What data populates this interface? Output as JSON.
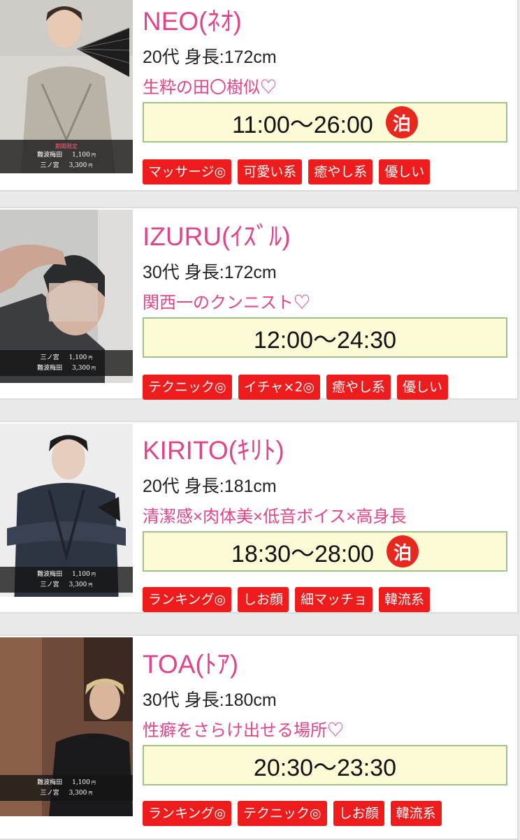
{
  "colors": {
    "accent": "#e0458a",
    "tag_bg": "#ee1c1c",
    "hours_bg": "#fcfbd6",
    "hours_border": "#9fc28a",
    "stay_badge": "#e8281e"
  },
  "cast": [
    {
      "name": "NEO(ﾈｵ)",
      "info": "20代 身長:172cm",
      "catch": "生粋の田〇樹似♡",
      "hours": "11:00〜26:00",
      "stay": "泊",
      "price_note": "期間限定",
      "prices": [
        {
          "area": "難波梅田",
          "price": "1,100",
          "unit": "円"
        },
        {
          "area": "三ノ宮",
          "price": "3,300",
          "unit": "円"
        }
      ],
      "tags": [
        "マッサージ◎",
        "可愛い系",
        "癒やし系",
        "優しい"
      ]
    },
    {
      "name": "IZURU(ｲｽﾞﾙ)",
      "info": "30代 身長:172cm",
      "catch": "関西一のクンニスト♡",
      "hours": "12:00〜24:30",
      "prices": [
        {
          "area": "三ノ宮",
          "price": "1,100",
          "unit": "円"
        },
        {
          "area": "難波梅田",
          "price": "3,300",
          "unit": "円"
        }
      ],
      "tags": [
        "テクニック◎",
        "イチャ×2◎",
        "癒やし系",
        "優しい"
      ]
    },
    {
      "name": "KIRITO(ｷﾘﾄ)",
      "info": "20代 身長:181cm",
      "catch": "清潔感×肉体美×低音ボイス×高身長",
      "hours": "18:30〜28:00",
      "stay": "泊",
      "prices": [
        {
          "area": "難波梅田",
          "price": "1,100",
          "unit": "円"
        },
        {
          "area": "三ノ宮",
          "price": "3,300",
          "unit": "円"
        }
      ],
      "tags": [
        "ランキング◎",
        "しお顔",
        "細マッチョ",
        "韓流系"
      ]
    },
    {
      "name": "TOA(ﾄｱ)",
      "info": "30代 身長:180cm",
      "catch": "性癖をさらけ出せる場所♡",
      "hours": "20:30〜23:30",
      "prices": [
        {
          "area": "難波梅田",
          "price": "1,100",
          "unit": "円"
        },
        {
          "area": "三ノ宮",
          "price": "3,300",
          "unit": "円"
        }
      ],
      "tags": [
        "ランキング◎",
        "テクニック◎",
        "しお顔",
        "韓流系"
      ]
    }
  ]
}
